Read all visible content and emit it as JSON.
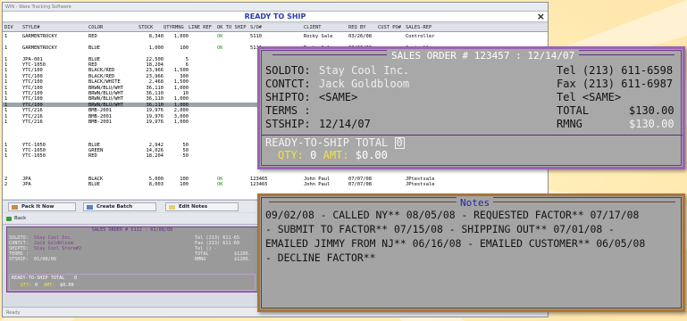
{
  "window": {
    "title": "WIN - Ware Tracking Software",
    "heading": "READY TO SHIP",
    "close": "×",
    "status": "Ready"
  },
  "grid": {
    "headers": [
      "DIV",
      "STYLE#",
      "COLOR",
      "STOCK",
      "QTYRMNG",
      "LINE REF",
      "OK TO SHIP",
      "S/O#",
      "CLIENT",
      "REQ BY",
      "CUST PO#",
      "SALES-REP"
    ],
    "rows": [
      [
        "1",
        "GARMENTROCKY",
        "RED",
        "8,340",
        "1,000",
        "",
        "OK",
        "5110",
        "Rocky Sale",
        "03/26/08",
        "",
        "Controller"
      ],
      [
        "",
        "",
        "",
        "",
        "",
        "",
        "",
        "",
        "",
        "",
        "",
        ""
      ],
      [
        "1",
        "GARMENTROCKY",
        "BLUE",
        "1,000",
        "100",
        "",
        "OK",
        "5111",
        "Rocky Sale",
        "03/26/08",
        "",
        "Controller"
      ],
      [
        "",
        "",
        "",
        "",
        "",
        "",
        "",
        "",
        "",
        "",
        "",
        ""
      ],
      [
        "1",
        "JPA-001",
        "BLUE",
        "22,500",
        "5",
        "",
        "",
        "",
        "",
        "",
        "",
        ""
      ],
      [
        "1",
        "YTC-1050",
        "RED",
        "18,204",
        "6",
        "",
        "",
        "",
        "",
        "",
        "",
        ""
      ],
      [
        "1",
        "YTC/100",
        "BLACK/RED",
        "23,966",
        "1,500",
        "",
        "",
        "",
        "",
        "",
        "",
        ""
      ],
      [
        "1",
        "YTC/100",
        "BLACK/RED",
        "23,966",
        "300",
        "",
        "",
        "",
        "",
        "",
        "",
        ""
      ],
      [
        "1",
        "YTC/100",
        "BLACK/WHITE",
        "2,468",
        "1,500",
        "",
        "",
        "",
        "",
        "",
        "",
        ""
      ],
      [
        "1",
        "YTC/100",
        "BRWN/BLU/WHT",
        "36,110",
        "1,000",
        "",
        "",
        "",
        "",
        "",
        "",
        ""
      ],
      [
        "1",
        "YTC/100",
        "BRWN/BLU/WHT",
        "36,110",
        "10",
        "",
        "",
        "",
        "",
        "",
        "",
        ""
      ],
      [
        "1",
        "YTC/100",
        "BRWN/BLU/WHT",
        "36,110",
        "1,000",
        "",
        "",
        "",
        "",
        "",
        "",
        ""
      ],
      [
        "1",
        "YTC/100",
        "BRWN/BLU/WHT",
        "36,110",
        "1,000",
        "",
        "",
        "",
        "",
        "",
        "",
        ""
      ],
      [
        "1",
        "YTC/216",
        "BMB-2001",
        "19,976",
        "2,000",
        "",
        "",
        "",
        "",
        "",
        "",
        ""
      ],
      [
        "1",
        "YTC/216",
        "BMB-2001",
        "19,976",
        "3,000",
        "",
        "",
        "",
        "",
        "",
        "",
        ""
      ],
      [
        "1",
        "YTC/216",
        "BMB-2001",
        "19,976",
        "1,000",
        "",
        "",
        "",
        "",
        "",
        "",
        ""
      ],
      [
        "",
        "",
        "",
        "",
        "",
        "",
        "",
        "",
        "",
        "",
        "",
        ""
      ],
      [
        "",
        "",
        "",
        "",
        "",
        "",
        "",
        "",
        "",
        "",
        "",
        ""
      ],
      [
        "",
        "",
        "",
        "",
        "",
        "",
        "",
        "",
        "",
        "",
        "",
        ""
      ],
      [
        "1",
        "YTC-1050",
        "BLUE",
        "2,942",
        "50",
        "",
        "",
        "",
        "",
        "",
        "",
        ""
      ],
      [
        "1",
        "YTC-1050",
        "GREEN",
        "14,026",
        "50",
        "",
        "",
        "",
        "",
        "",
        "",
        ""
      ],
      [
        "1",
        "YTC-1050",
        "RED",
        "18,204",
        "50",
        "",
        "",
        "",
        "",
        "",
        "",
        ""
      ],
      [
        "",
        "",
        "",
        "",
        "",
        "",
        "",
        "",
        "",
        "",
        "",
        ""
      ],
      [
        "",
        "",
        "",
        "",
        "",
        "",
        "",
        "",
        "",
        "",
        "",
        ""
      ],
      [
        "",
        "",
        "",
        "",
        "",
        "",
        "",
        "",
        "",
        "",
        "",
        ""
      ],
      [
        "2",
        "JPA",
        "BLACK",
        "5,000",
        "100",
        "",
        "OK",
        "123465",
        "John Paul",
        "07/07/08",
        "",
        "JPtestsale"
      ],
      [
        "2",
        "JPA",
        "BLUE",
        "8,003",
        "100",
        "",
        "OK",
        "123465",
        "John Paul",
        "07/07/08",
        "",
        "JPtestsale"
      ]
    ]
  },
  "buttons": {
    "pack": "Pack It Now",
    "batch": "Create Batch",
    "edit": "Edit Notes",
    "back": "Back"
  },
  "small_order": {
    "header": "SALES ORDER # 5112 : 01/08/08",
    "soldto_l": "SOLDTO:",
    "soldto": "Stay Cool Inc.",
    "contct_l": "CONTCT:",
    "contct": "Jack Goldbloom",
    "shipto_l": "SHIPTO:",
    "shipto": "Stay Cool Store#2",
    "terms_l": "TERMS :",
    "stship_l": "STSHIP:",
    "stship": "01/08/08",
    "tel": "Tel (213) 611-65",
    "fax": "Fax (213) 611-69",
    "tel2": "Tel () -",
    "total_l": "TOTAL",
    "total": "$1200.",
    "rmng_l": "RMNG",
    "rmng": "$1200.",
    "rts": "READY-TO-SHIP TOTAL",
    "rts_val": "0",
    "qty_l": "QTY:",
    "qty": "0",
    "amt_l": "AMT:",
    "amt": "$0.00"
  },
  "big_order": {
    "header": "SALES ORDER # 123457 : 12/14/07",
    "soldto_l": "SOLDTO:",
    "soldto": "Stay Cool Inc.",
    "contct_l": "CONTCT:",
    "contct": "Jack Goldbloom",
    "shipto_l": "SHIPTO:",
    "shipto": "<SAME>",
    "terms_l": "TERMS :",
    "stship_l": "STSHIP:",
    "stship": "12/14/07",
    "tel": "Tel (213) 611-6598",
    "fax": "Fax (213) 611-6987",
    "tel2": "Tel <SAME>",
    "total_l": "TOTAL",
    "total": "$130.00",
    "rmng_l": "RMNG",
    "rmng": "$130.00",
    "rts": "READY-TO-SHIP TOTAL",
    "rts_val": "0",
    "qty_l": "QTY:",
    "qty": "0",
    "amt_l": "AMT:",
    "amt": "$0.00"
  },
  "notes": {
    "title": "Notes",
    "lines": [
      "09/02/08 - CALLED NY** 08/05/08 - REQUESTED FACTOR** 07/17/08",
      "- SUBMIT TO FACTOR** 07/15/08 - SHIPPING OUT** 07/01/08 -",
      "EMAILED JIMMY FROM NJ** 06/16/08 - EMAILED CUSTOMER** 06/05/08",
      "- DECLINE FACTOR**"
    ]
  }
}
